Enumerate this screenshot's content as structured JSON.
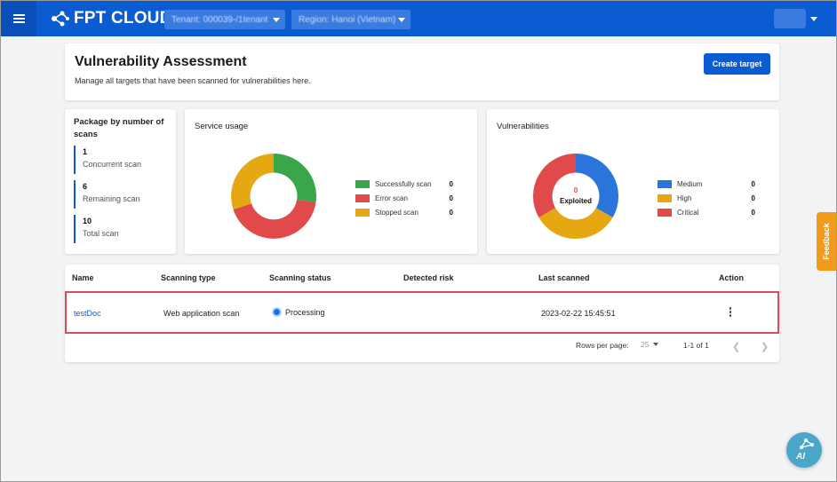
{
  "topbar": {
    "logo_text": "FPT CLOUD",
    "tenant_select": "Tenant: 000039-/1tenant",
    "region_select": "Region: Hanoi (Vietnam)"
  },
  "header": {
    "title": "Vulnerability Assessment",
    "subtitle": "Manage all targets that have been scanned for vulnerabilities here.",
    "create_button": "Create target"
  },
  "package": {
    "title": "Package by number of scans",
    "stats": [
      {
        "value": "1",
        "label": "Concurrent scan"
      },
      {
        "value": "6",
        "label": "Remaining scan"
      },
      {
        "value": "10",
        "label": "Total scan"
      }
    ]
  },
  "service_usage": {
    "title": "Service usage",
    "legend": [
      {
        "label": "Successfully scan",
        "value": "0",
        "color": "#3aa64a"
      },
      {
        "label": "Error scan",
        "value": "0",
        "color": "#e04a4a"
      },
      {
        "label": "Stopped scan",
        "value": "0",
        "color": "#e6a812"
      }
    ]
  },
  "vulnerabilities": {
    "title": "Vulnerabilities",
    "center_value": "0",
    "center_label": "Exploited",
    "legend": [
      {
        "label": "Medium",
        "value": "0",
        "color": "#2a74dc"
      },
      {
        "label": "High",
        "value": "0",
        "color": "#e6a812"
      },
      {
        "label": "Critical",
        "value": "0",
        "color": "#e04a4a"
      }
    ]
  },
  "table": {
    "columns": [
      "Name",
      "Scanning type",
      "Scanning status",
      "Detected risk",
      "Last scanned",
      "Action"
    ],
    "rows": [
      {
        "name": "testDoc",
        "type": "Web application scan",
        "status": "Processing",
        "risk": "",
        "last_scanned": "2023-02-22 15:45:51"
      }
    ],
    "pagination": {
      "rows_per_page_label": "Rows per page:",
      "rows_per_page": "25",
      "range": "1-1 of 1"
    }
  },
  "feedback_label": "Feedback",
  "ai_label": "AI"
}
